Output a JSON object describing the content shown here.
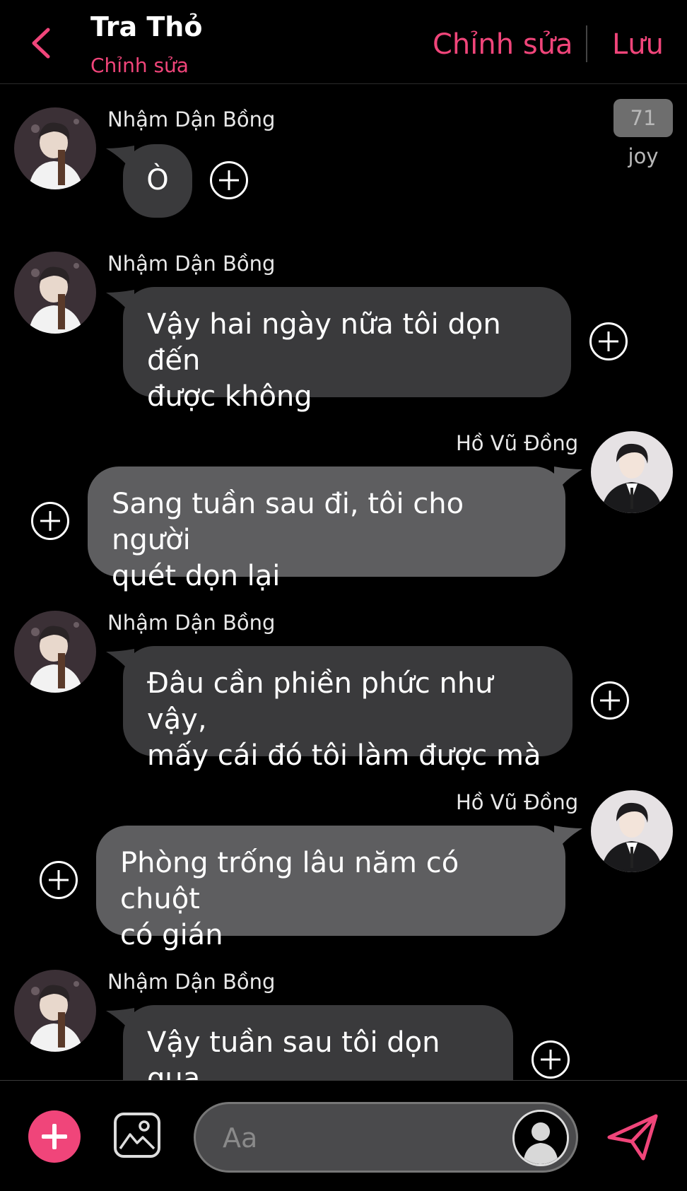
{
  "header": {
    "title": "Tra Thỏ",
    "subtitle": "Chỉnh sửa",
    "edit_label": "Chỉnh sửa",
    "save_label": "Lưu",
    "accent": "#f0457a"
  },
  "watermark": "71 joy",
  "messages": [
    {
      "side": "left",
      "sender": "Nhậm Dận Bồng",
      "text": "Ò"
    },
    {
      "side": "left",
      "sender": "Nhậm Dận Bồng",
      "text": "Vậy hai ngày nữa tôi dọn đến\nđược không"
    },
    {
      "side": "right",
      "sender": "Hồ Vũ Đồng",
      "text": "Sang tuần sau đi, tôi cho người\nquét dọn lại"
    },
    {
      "side": "left",
      "sender": "Nhậm Dận Bồng",
      "text": "Đâu cần phiền phức như vậy,\nmấy cái đó tôi làm được mà"
    },
    {
      "side": "right",
      "sender": "Hồ Vũ Đồng",
      "text": "Phòng trống lâu năm có chuột\ncó gián"
    },
    {
      "side": "left",
      "sender": "Nhậm Dận Bồng",
      "text": "Vậy tuần sau tôi dọn qua\ncũng được"
    }
  ],
  "composer": {
    "placeholder": "Aa",
    "icons": [
      "add-icon",
      "image-icon",
      "user-avatar-icon",
      "send-icon"
    ]
  }
}
